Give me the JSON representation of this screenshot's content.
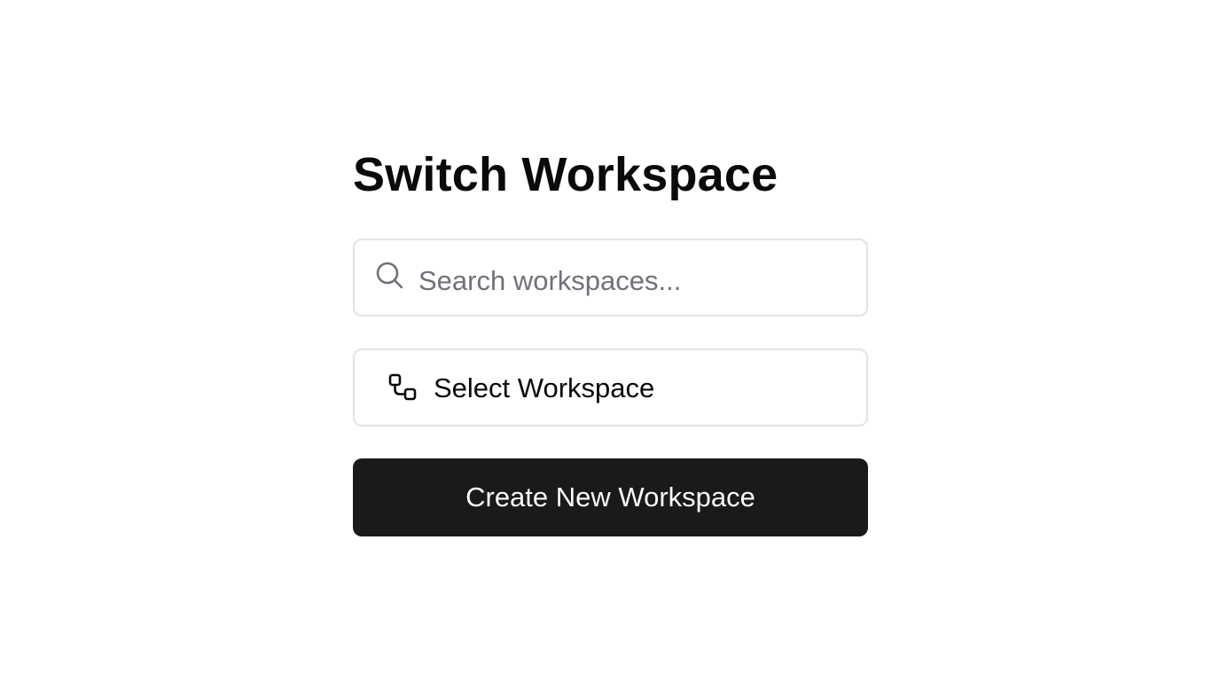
{
  "page": {
    "title": "Switch Workspace"
  },
  "search": {
    "placeholder": "Search workspaces...",
    "value": "",
    "icon": "search-icon"
  },
  "workspace_select": {
    "label": "Select Workspace",
    "icon": "workspace-switch-icon"
  },
  "create_button": {
    "label": "Create New Workspace"
  },
  "colors": {
    "background": "#ffffff",
    "text": "#0a0a0a",
    "border": "#e4e4e7",
    "placeholder": "#71717a",
    "primary_button": "#1a1a1c",
    "primary_button_text": "#fafafa"
  }
}
